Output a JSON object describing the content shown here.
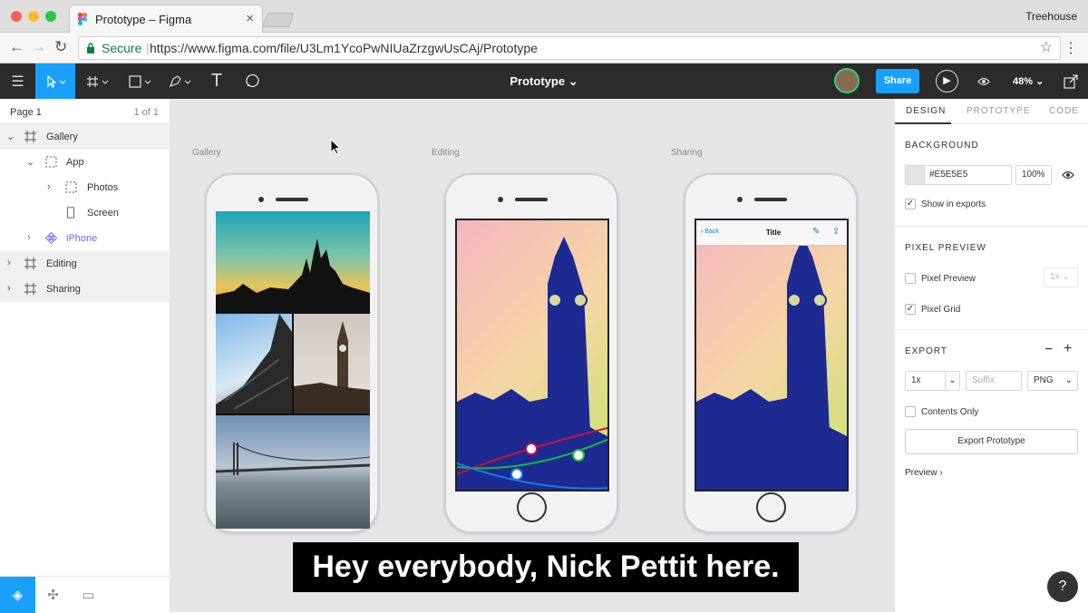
{
  "browser": {
    "tab_title": "Prototype – Figma",
    "user": "Treehouse",
    "secure_label": "Secure",
    "url": "https://www.figma.com/file/U3Lm1YcoPwNIUaZrzgwUsCAj/Prototype"
  },
  "toolbar": {
    "file_title": "Prototype",
    "share_label": "Share",
    "zoom": "48%"
  },
  "pages": {
    "current": "Page 1",
    "count": "1 of 1"
  },
  "layers": [
    {
      "name": "Gallery"
    },
    {
      "name": "App"
    },
    {
      "name": "Photos"
    },
    {
      "name": "Screen"
    },
    {
      "name": "iPhone"
    },
    {
      "name": "Editing"
    },
    {
      "name": "Sharing"
    }
  ],
  "frames": {
    "gallery": "Gallery",
    "editing": "Editing",
    "sharing": "Sharing"
  },
  "sharing_screen": {
    "back": "Back",
    "title": "Title"
  },
  "subtitle": "Hey everybody, Nick Pettit here.",
  "panel": {
    "tabs": [
      "DESIGN",
      "PROTOTYPE",
      "CODE"
    ],
    "background": {
      "heading": "BACKGROUND",
      "hex": "#E5E5E5",
      "opacity": "100%",
      "swatch": "#E5E5E5",
      "show_in_exports": "Show in exports"
    },
    "pixel_preview": {
      "heading": "PIXEL PREVIEW",
      "preview": "Pixel Preview",
      "scale": "1x",
      "grid": "Pixel Grid"
    },
    "export": {
      "heading": "EXPORT",
      "scale": "1x",
      "suffix_placeholder": "Suffix",
      "format": "PNG",
      "contents_only": "Contents Only",
      "export_button": "Export Prototype",
      "preview": "Preview"
    }
  },
  "help": "?"
}
